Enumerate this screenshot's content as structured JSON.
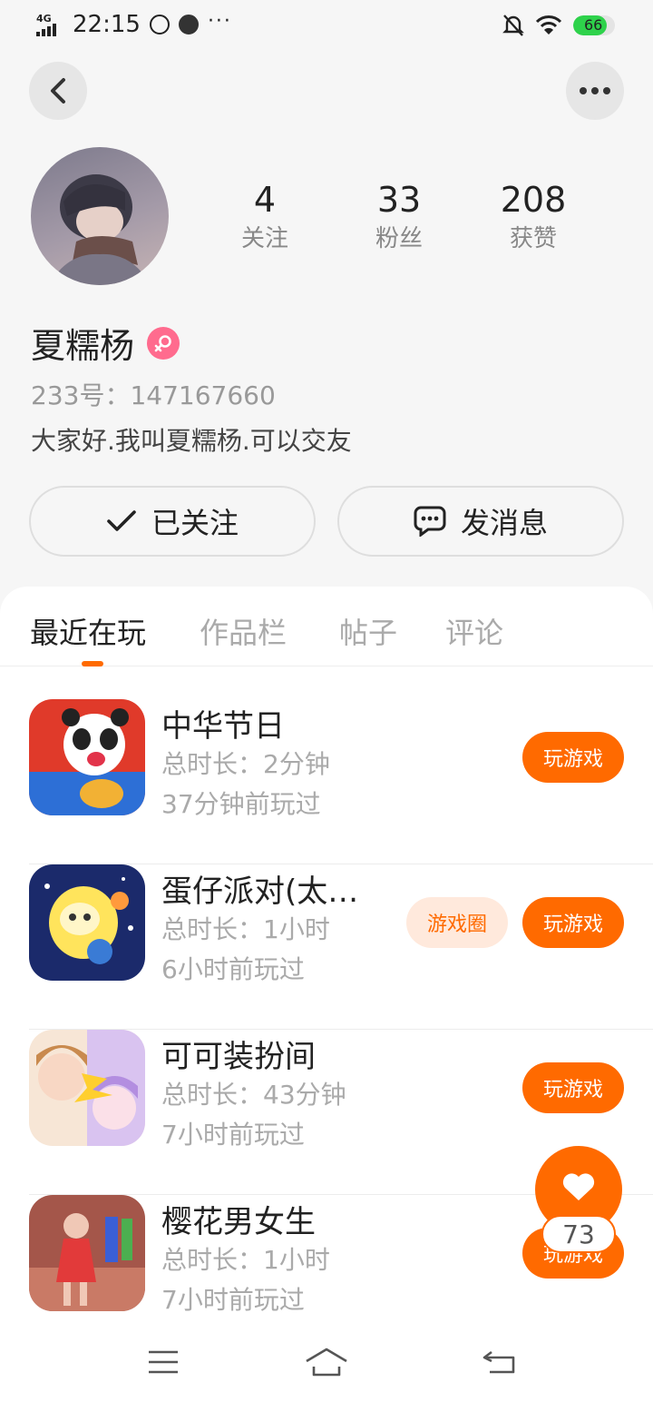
{
  "status_bar": {
    "network": "4G",
    "time": "22:15",
    "more": "···",
    "battery": "66"
  },
  "profile": {
    "stats": [
      {
        "value": "4",
        "label": "关注"
      },
      {
        "value": "33",
        "label": "粉丝"
      },
      {
        "value": "208",
        "label": "获赞"
      }
    ],
    "username": "夏糯杨",
    "gender": "female",
    "uid_label": "233号：",
    "uid": "147167660",
    "bio": "大家好.我叫夏糯杨.可以交友"
  },
  "actions": {
    "follow_label": "已关注",
    "message_label": "发消息"
  },
  "tabs": [
    {
      "label": "最近在玩",
      "active": true
    },
    {
      "label": "作品栏",
      "active": false
    },
    {
      "label": "帖子",
      "active": false
    },
    {
      "label": "评论",
      "active": false
    }
  ],
  "games": [
    {
      "name": "中华节日",
      "duration": "总时长：2分钟",
      "last_played": "37分钟前玩过",
      "play_label": "玩游戏"
    },
    {
      "name": "蛋仔派对(太…",
      "duration": "总时长：1小时",
      "last_played": "6小时前玩过",
      "circle_label": "游戏圈",
      "play_label": "玩游戏"
    },
    {
      "name": "可可装扮间",
      "duration": "总时长：43分钟",
      "last_played": "7小时前玩过",
      "play_label": "玩游戏"
    },
    {
      "name": "樱花男女生",
      "duration": "总时长：1小时",
      "last_played": "7小时前玩过",
      "play_label": "玩游戏"
    }
  ],
  "like_fab": {
    "count": "73"
  },
  "colors": {
    "accent": "#ff6a00",
    "gender_female": "#ff6b8e",
    "battery": "#2ed24b"
  },
  "icons": [
    "back-icon",
    "more-icon",
    "check-icon",
    "chat-bubble-icon",
    "heart-icon",
    "menu-icon",
    "home-icon",
    "return-icon"
  ]
}
